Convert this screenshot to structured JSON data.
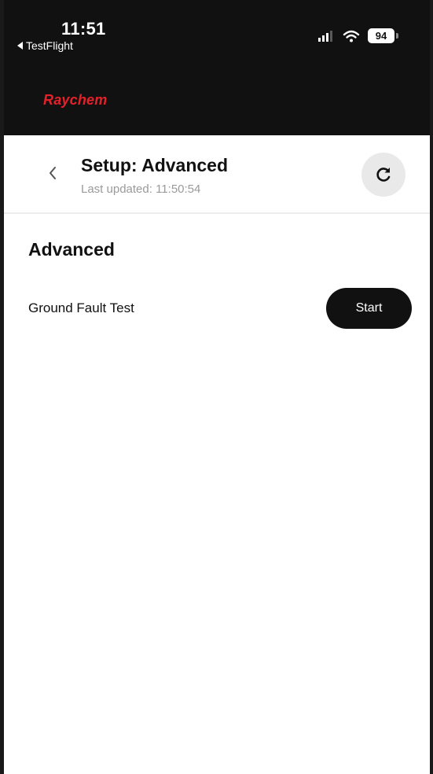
{
  "status_bar": {
    "time": "11:51",
    "back_app": "TestFlight",
    "battery": "94"
  },
  "brand": {
    "name": "Raychem",
    "color": "#e4202a"
  },
  "header": {
    "title": "Setup: Advanced",
    "last_updated": "Last updated: 11:50:54",
    "back_icon": "chevron-left-icon",
    "refresh_icon": "refresh-icon"
  },
  "section": {
    "title": "Advanced",
    "items": [
      {
        "label": "Ground Fault Test",
        "action": "Start"
      }
    ]
  }
}
